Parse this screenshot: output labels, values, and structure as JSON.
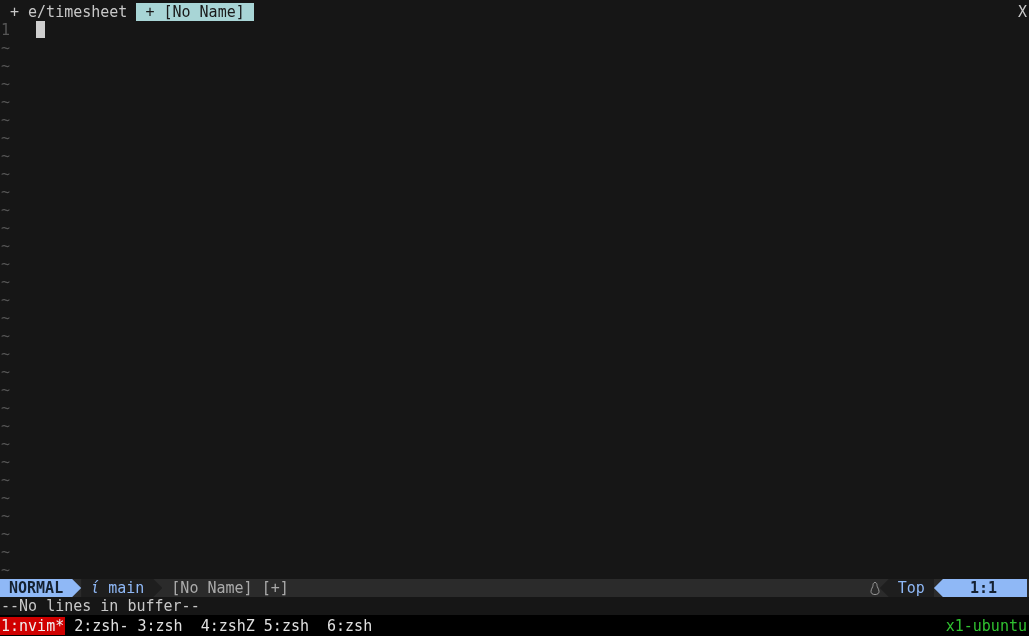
{
  "tabline": {
    "tabs": [
      {
        "label": "+ e/timesheet",
        "selected": false
      },
      {
        "label": "+ [No Name]",
        "selected": true
      }
    ],
    "close": "X"
  },
  "buffer": {
    "line_numbers": [
      "1"
    ],
    "cursor": true,
    "filler": [
      "~",
      "~",
      "~",
      "~",
      "~",
      "~",
      "~",
      "~",
      "~",
      "~",
      "~",
      "~",
      "~",
      "~",
      "~",
      "~",
      "~",
      "~",
      "~",
      "~",
      "~",
      "~",
      "~",
      "~",
      "~",
      "~",
      "~",
      "~",
      "~",
      "~"
    ]
  },
  "statusline": {
    "mode": "NORMAL",
    "branch_icon": "ί",
    "branch": "main",
    "file": "[No Name] [+]",
    "position": "Top",
    "cursor_position": "1:1"
  },
  "message": "--No lines in buffer--",
  "tmux": {
    "windows": [
      {
        "label": "1:nvim*",
        "selected": true
      },
      {
        "label": "2:zsh-",
        "selected": false
      },
      {
        "label": "3:zsh",
        "selected": false
      },
      {
        "label": "4:zshZ",
        "selected": false
      },
      {
        "label": "5:zsh",
        "selected": false
      },
      {
        "label": "6:zsh",
        "selected": false
      }
    ],
    "host": "x1-ubuntu"
  }
}
